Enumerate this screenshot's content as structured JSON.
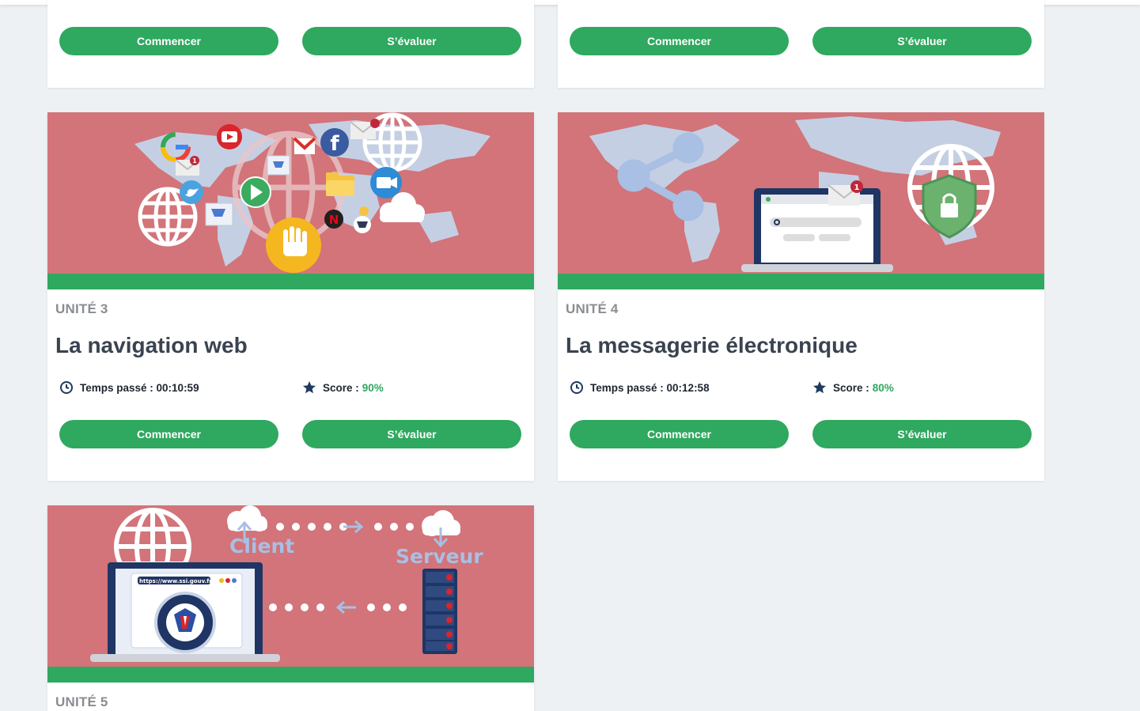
{
  "colors": {
    "accent_green": "#2fa860",
    "card_image_bg": "#d27479",
    "page_bg": "#eef1f3",
    "title_text": "#3a4350"
  },
  "top_cards": [
    {
      "start_label": "Commencer",
      "evaluate_label": "S’évaluer"
    },
    {
      "start_label": "Commencer",
      "evaluate_label": "S’évaluer"
    }
  ],
  "cards": [
    {
      "unit": "UNITÉ 3",
      "title": "La navigation web",
      "time_label": "Temps passé : 00:10:59",
      "score_label": "Score :",
      "score_value": "90%",
      "start_label": "Commencer",
      "evaluate_label": "S’évaluer",
      "image_icons": [
        "globe-icon",
        "google-icon",
        "youtube-icon",
        "gmail-icon",
        "facebook-icon",
        "twitter-icon",
        "play-icon",
        "folder-icon",
        "video-icon",
        "netflix-icon",
        "cart-icon",
        "cloud-icon",
        "hand-stop-icon",
        "mail-icon"
      ]
    },
    {
      "unit": "UNITÉ 4",
      "title": "La messagerie électronique",
      "time_label": "Temps passé : 00:12:58",
      "score_label": "Score :",
      "score_value": "80%",
      "start_label": "Commencer",
      "evaluate_label": "S’évaluer",
      "image_icons": [
        "share-icon",
        "laptop-icon",
        "mail-icon",
        "search-icon",
        "globe-icon",
        "shield-lock-icon"
      ]
    },
    {
      "unit": "UNITÉ 5",
      "image_labels": {
        "client": "Client",
        "server": "Serveur",
        "url": "https://www.ssi.gouv.fr"
      },
      "image_icons": [
        "globe-icon",
        "cloud-upload-icon",
        "cloud-download-icon",
        "laptop-icon",
        "server-icon",
        "anssi-logo"
      ]
    }
  ]
}
